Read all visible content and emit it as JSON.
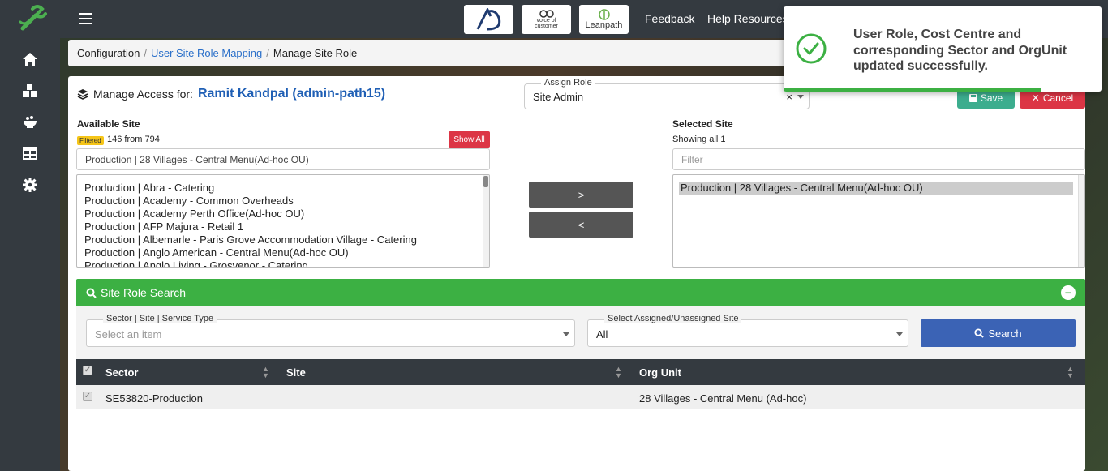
{
  "colors": {
    "sidebar": "#343a40",
    "accent_green": "#3cb043",
    "link_blue": "#2a6fc9",
    "danger": "#dc3545",
    "search_blue": "#3b63b5",
    "save_teal": "#3cad8e"
  },
  "sidebar": {
    "icons": [
      "home-icon",
      "boxes-icon",
      "food-bowl-icon",
      "table-icon",
      "gear-icon"
    ]
  },
  "topbar": {
    "brands": [
      "logo-ad",
      "voice of customer",
      "Leanpath"
    ],
    "links": {
      "feedback": "Feedback",
      "help": "Help Resources"
    }
  },
  "breadcrumb": {
    "root": "Configuration",
    "mapping": "User Site Role Mapping",
    "current": "Manage Site Role"
  },
  "manage": {
    "label": "Manage Access for:",
    "user": "Ramit Kandpal (admin-path15)",
    "assign_role_legend": "Assign Role",
    "assign_role_value": "Site Admin",
    "assign_role_clear": "×",
    "save": "Save",
    "cancel": "Cancel"
  },
  "available": {
    "title": "Available Site",
    "filtered_badge": "Filtered",
    "count_text": "146 from 794",
    "show_all": "Show All",
    "filter_value": "Production | 28 Villages - Central Menu(Ad-hoc OU)",
    "items": [
      "Production | Abra - Catering",
      "Production | Academy - Common Overheads",
      "Production | Academy Perth Office(Ad-hoc OU)",
      "Production | AFP Majura - Retail 1",
      "Production | Albemarle - Paris Grove Accommodation Village - Catering",
      "Production | Anglo American - Central Menu(Ad-hoc OU)",
      "Production | Anglo Living - Grosvenor - Catering"
    ]
  },
  "move": {
    "add": ">",
    "remove": "<"
  },
  "selected": {
    "title": "Selected Site",
    "showing": "Showing all 1",
    "filter_placeholder": "Filter",
    "items": [
      "Production | 28 Villages - Central Menu(Ad-hoc OU)"
    ]
  },
  "search_panel": {
    "title": "Site Role Search",
    "collapse": "−",
    "sector_legend": "Sector | Site | Service Type",
    "sector_placeholder": "Select an item",
    "assigned_legend": "Select Assigned/Unassigned Site",
    "assigned_value": "All",
    "search_button": "Search"
  },
  "table": {
    "columns": [
      "Sector",
      "Site",
      "Org Unit"
    ],
    "rows": [
      {
        "sector": "SE53820-Production",
        "site": "",
        "org_unit": "28 Villages - Central Menu (Ad-hoc)"
      }
    ]
  },
  "toast": {
    "message": "User Role, Cost Centre and corresponding Sector and OrgUnit updated successfully.",
    "progress": 0.81
  }
}
